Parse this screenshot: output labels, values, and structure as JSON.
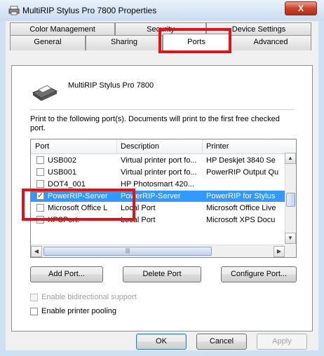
{
  "window": {
    "title": "MultiRIP Stylus Pro 7800 Properties",
    "close_label": "X"
  },
  "tabs": {
    "row1": [
      "Color Management",
      "Security",
      "Device Settings"
    ],
    "row2": [
      "General",
      "Sharing",
      "Ports",
      "Advanced"
    ],
    "active": "Ports"
  },
  "printer": {
    "name": "MultiRIP Stylus Pro 7800"
  },
  "description": "Print to the following port(s). Documents will print to the first free checked port.",
  "ports_table": {
    "columns": [
      "Port",
      "Description",
      "Printer"
    ],
    "rows": [
      {
        "port": "USB002",
        "description": "Virtual printer port fo...",
        "printer": "HP Deskjet 3840 Se",
        "checked": false,
        "selected": false
      },
      {
        "port": "USB001",
        "description": "Virtual printer port fo...",
        "printer": "PowerRIP Output Qu",
        "checked": false,
        "selected": false
      },
      {
        "port": "DOT4_001",
        "description": "HP Photosmart 420...",
        "printer": "",
        "checked": false,
        "selected": false
      },
      {
        "port": "PowerRIP-Server",
        "description": "PowerRIP-Server",
        "printer": "PowerRIP for Stylus",
        "checked": true,
        "selected": true
      },
      {
        "port": "Microsoft Office L",
        "description": "Local Port",
        "printer": "Microsoft Office Live",
        "checked": false,
        "selected": false
      },
      {
        "port": "XPSPort:",
        "description": "Local Port",
        "printer": "Microsoft XPS Docu",
        "checked": false,
        "selected": false
      }
    ]
  },
  "buttons": {
    "add_port": "Add Port...",
    "delete_port": "Delete Port",
    "configure_port": "Configure Port...",
    "ok": "OK",
    "cancel": "Cancel",
    "apply": "Apply"
  },
  "options": {
    "bidirectional": {
      "label": "Enable bidirectional support",
      "checked": false,
      "enabled": false
    },
    "pooling": {
      "label": "Enable printer pooling",
      "checked": false,
      "enabled": true
    }
  },
  "colors": {
    "highlight": "#e0131a",
    "selection": "#3399ff"
  }
}
